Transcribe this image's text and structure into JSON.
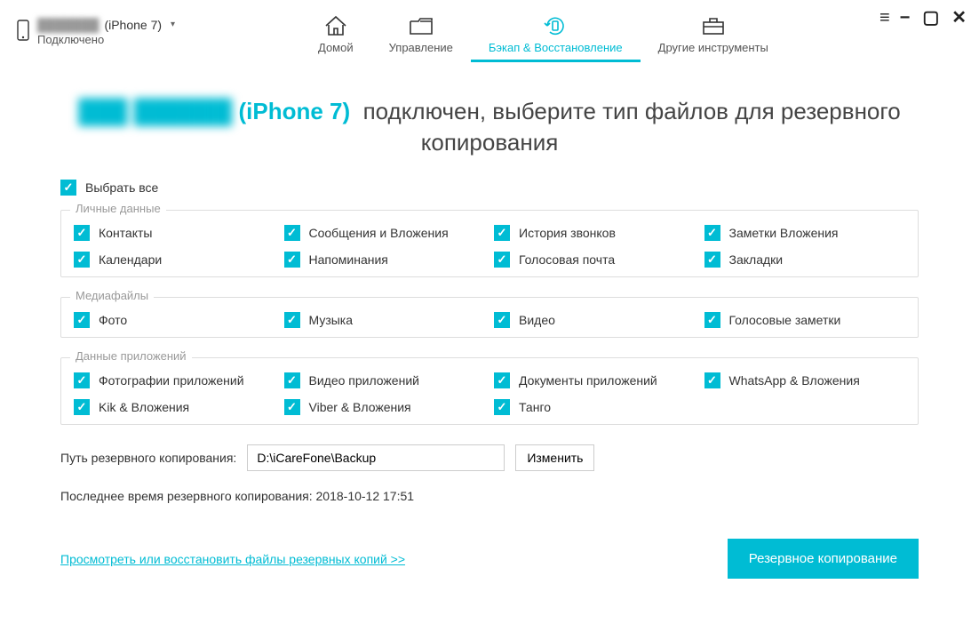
{
  "device": {
    "name_hidden": "███████",
    "model": "(iPhone 7)",
    "status": "Подключено"
  },
  "nav": {
    "home": "Домой",
    "manage": "Управление",
    "backup": "Бэкап & Восстановление",
    "tools": "Другие инструменты"
  },
  "headline": {
    "name_hidden": "███ ██████",
    "model": "(iPhone 7)",
    "text1": "подключен, выберите тип файлов для резервного",
    "text2": "копирования"
  },
  "select_all": "Выбрать все",
  "groups": {
    "personal": {
      "title": "Личные данные",
      "items": [
        "Контакты",
        "Сообщения и Вложения",
        "История звонков",
        "Заметки Вложения",
        "Календари",
        "Напоминания",
        "Голосовая почта",
        "Закладки"
      ]
    },
    "media": {
      "title": "Медиафайлы",
      "items": [
        "Фото",
        "Музыка",
        "Видео",
        "Голосовые заметки"
      ]
    },
    "apps": {
      "title": "Данные приложений",
      "items": [
        "Фотографии приложений",
        "Видео приложений",
        "Документы приложений",
        "WhatsApp & Вложения",
        "Kik & Вложения",
        "Viber & Вложения",
        "Танго"
      ]
    }
  },
  "path": {
    "label": "Путь резервного копирования:",
    "value": "D:\\iCareFone\\Backup",
    "change": "Изменить"
  },
  "last_backup": {
    "label": "Последнее время резервного копирования:",
    "value": "2018-10-12 17:51"
  },
  "view_link": "Просмотреть или восстановить файлы резервных копий >>",
  "backup_button": "Резервное копирование"
}
